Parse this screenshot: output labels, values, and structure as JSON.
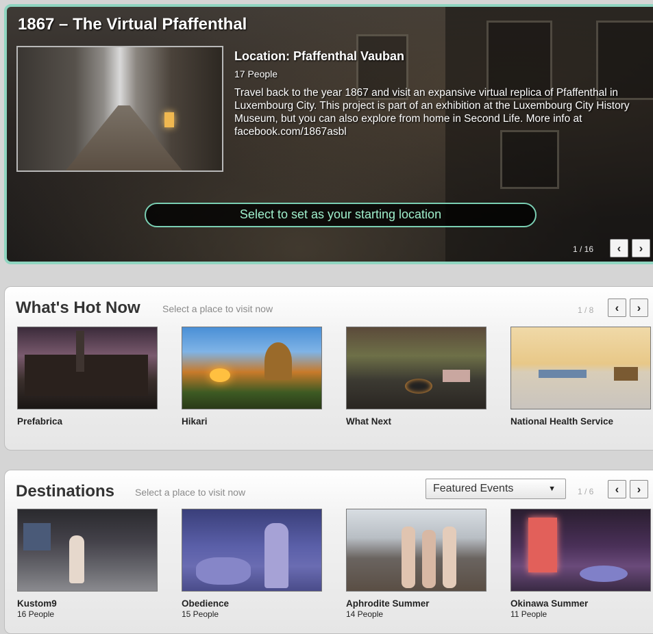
{
  "featured": {
    "title": "1867 – The Virtual Pfaffenthal",
    "location": "Location: Pfaffenthal Vauban",
    "people": "17 People",
    "description": "Travel back to the year 1867 and visit an expansive virtual replica of Pfaffenthal in Luxembourg City. This project is part of an exhibition at the Luxembourg City History Museum, but you can also explore from home in Second Life. More info at facebook.com/1867asbl",
    "start_button": "Select to set as your starting location",
    "page": "1 / 16",
    "accent": "#8fd5c0"
  },
  "whats_hot": {
    "title": "What's Hot Now",
    "subtitle": "Select a place to visit now",
    "page": "1 / 8",
    "items": [
      {
        "name": "Prefabrica"
      },
      {
        "name": "Hikari"
      },
      {
        "name": "What Next"
      },
      {
        "name": "National Health Service"
      }
    ]
  },
  "destinations": {
    "title": "Destinations",
    "subtitle": "Select a place to visit now",
    "filter": "Featured Events",
    "page": "1 / 6",
    "items": [
      {
        "name": "Kustom9",
        "people": "16 People"
      },
      {
        "name": "Obedience",
        "people": "15 People"
      },
      {
        "name": "Aphrodite Summer",
        "people": "14 People"
      },
      {
        "name": "Okinawa Summer",
        "people": "11 People"
      }
    ]
  },
  "icons": {
    "prev": "‹",
    "next": "›",
    "caret": "▼"
  }
}
